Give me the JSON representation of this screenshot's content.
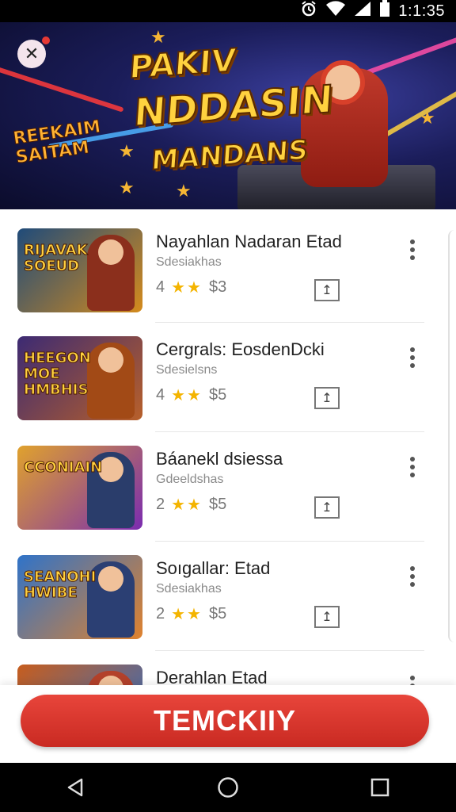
{
  "status_bar": {
    "time": "1:1:35",
    "icons": [
      "alarm-icon",
      "wifi-icon",
      "signal-icon",
      "battery-icon"
    ]
  },
  "banner": {
    "title_lines": [
      "PAKIV",
      "NDDASIN",
      "MANDANS"
    ],
    "side_text": [
      "REEKAIM",
      "SAITAM"
    ],
    "close_icon": "close-icon"
  },
  "games": [
    {
      "title": "Nayahlan Nadaran Etad",
      "subtitle": "Sdesiakhas",
      "rating": "4",
      "price": "$3",
      "thumb_text": [
        "RIJAVAK",
        "SOEUD"
      ],
      "thumb_colors": [
        "#1f4b7a",
        "#d58b1c"
      ],
      "char_color": "#8b2f1c"
    },
    {
      "title": "Cergrals: EosdenDcki",
      "subtitle": "Sdesielsns",
      "rating": "4",
      "price": "$5",
      "thumb_text": [
        "HEEGON",
        "MOE",
        "HMBHIS"
      ],
      "thumb_colors": [
        "#3c2a73",
        "#b8602a"
      ],
      "char_color": "#a24a16"
    },
    {
      "title": "Báanekl dsiessa",
      "subtitle": "Gdeeldshas",
      "rating": "2",
      "price": "$5",
      "thumb_text": [
        "CCONIAIN"
      ],
      "thumb_colors": [
        "#e0a22d",
        "#7a2bb0"
      ],
      "char_color": "#2a3d6b"
    },
    {
      "title": "Soıgallar: Etad",
      "subtitle": "Sdesiakhas",
      "rating": "2",
      "price": "$5",
      "thumb_text": [
        "SEANOHI",
        "HWIBE"
      ],
      "thumb_colors": [
        "#2f73c9",
        "#e0822d"
      ],
      "char_color": "#2b3f73"
    },
    {
      "title": "Derahlan Etad",
      "subtitle": "",
      "rating": "",
      "price": "",
      "thumb_text": [],
      "thumb_colors": [
        "#c75d1d",
        "#2d6fc9"
      ],
      "char_color": "#b3412a"
    }
  ],
  "cta": {
    "label": "TEMCKIIY"
  },
  "nav_bar": {
    "buttons": [
      "back-icon",
      "home-icon",
      "recents-icon"
    ]
  }
}
